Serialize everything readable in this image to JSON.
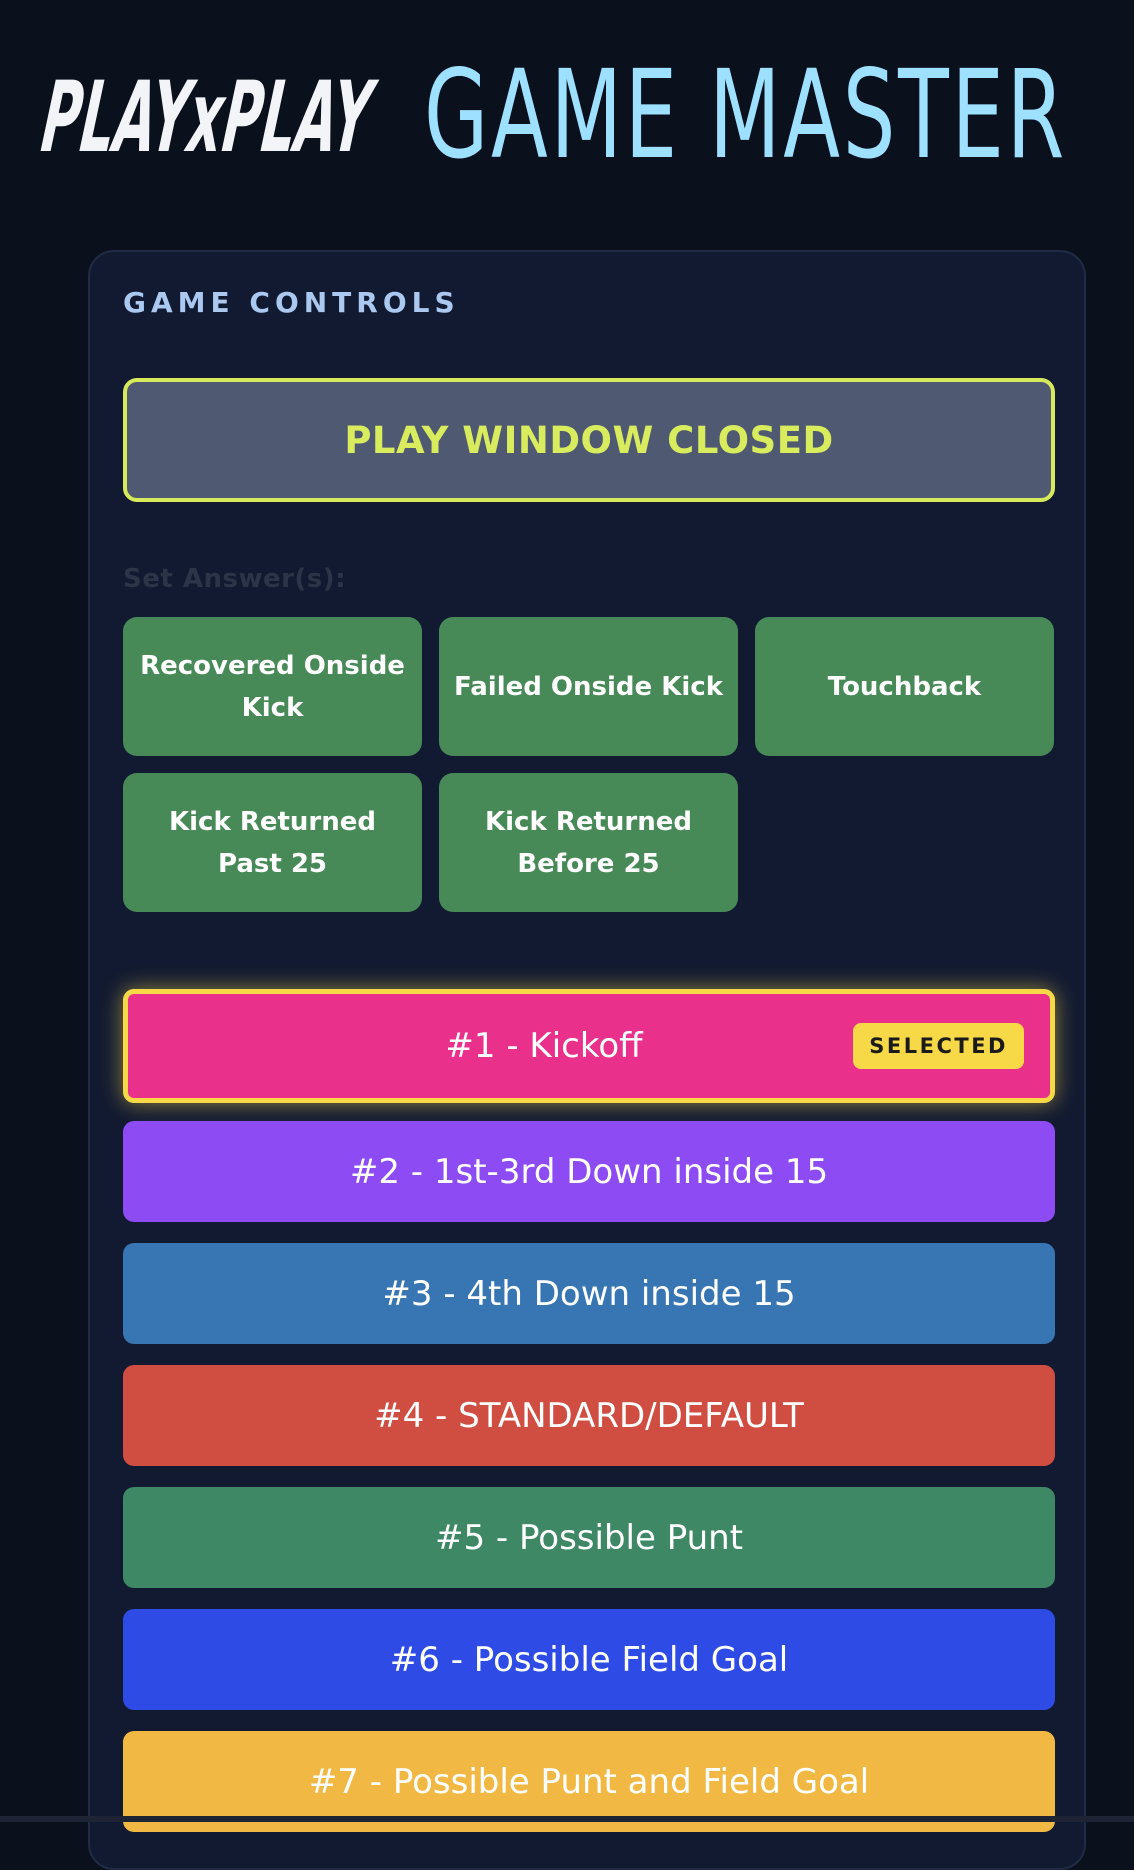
{
  "header": {
    "logo_text": "PLAYxPLAY",
    "title": "GAME MASTER",
    "colors": {
      "logo": "#ffffff",
      "title": "#9ee0ff"
    }
  },
  "controls": {
    "title": "GAME CONTROLS",
    "status": "PLAY WINDOW CLOSED",
    "set_answers_label": "Set Answer(s):",
    "answers": [
      "Recovered Onside Kick",
      "Failed Onside Kick",
      "Touchback",
      "Kick Returned Past 25",
      "Kick Returned Before 25"
    ],
    "plays": [
      {
        "label": "#1 - Kickoff",
        "color": "#e9318b",
        "selected": true
      },
      {
        "label": "#2 - 1st-3rd Down inside 15",
        "color": "#8d4bf3",
        "selected": false
      },
      {
        "label": "#3 - 4th Down inside 15",
        "color": "#3776b3",
        "selected": false
      },
      {
        "label": "#4 - STANDARD/DEFAULT",
        "color": "#cf4d41",
        "selected": false
      },
      {
        "label": "#5 - Possible Punt",
        "color": "#3e8866",
        "selected": false
      },
      {
        "label": "#6 - Possible Field Goal",
        "color": "#2e4ce5",
        "selected": false
      },
      {
        "label": "#7 - Possible Punt and Field Goal",
        "color": "#f1b943",
        "selected": false
      }
    ],
    "selected_badge": "SELECTED"
  }
}
